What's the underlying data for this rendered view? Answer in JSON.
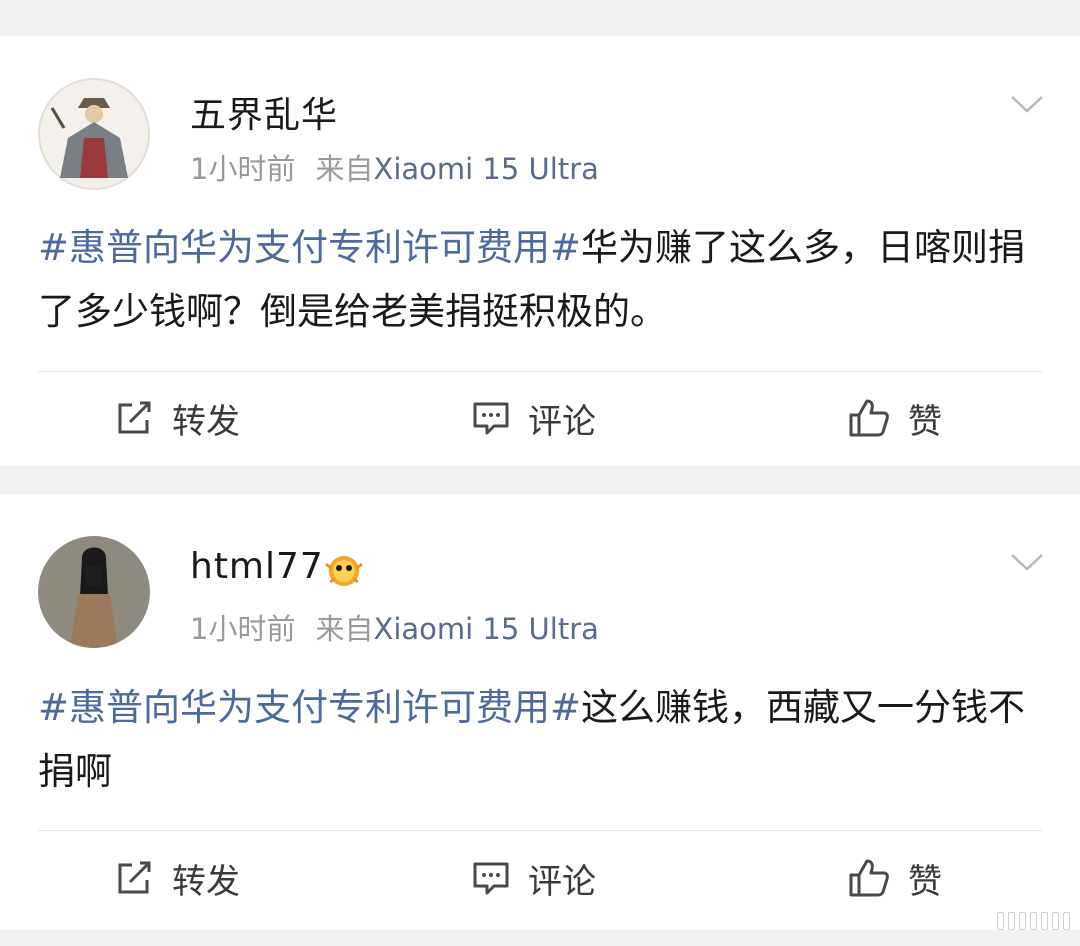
{
  "posts": [
    {
      "username": "五界乱华",
      "time": "1小时前",
      "source_prefix": "来自",
      "device": "Xiaomi 15 Ultra",
      "topic": "#惠普向华为支付专利许可费用#",
      "text": "华为赚了这么多，日喀则捐了多少钱啊？倒是给老美捐挺积极的。",
      "actions": {
        "repost": "转发",
        "comment": "评论",
        "like": "赞"
      }
    },
    {
      "username": "html77",
      "time": "1小时前",
      "source_prefix": "来自",
      "device": "Xiaomi 15 Ultra",
      "topic": "#惠普向华为支付专利许可费用#",
      "text": "这么赚钱，西藏又一分钱不捐啊",
      "actions": {
        "repost": "转发",
        "comment": "评论",
        "like": "赞"
      }
    }
  ],
  "colors": {
    "topic": "#4d6a9c",
    "device": "#5b6b8c",
    "meta": "#9a9a9a",
    "background": "#f2f2f2"
  },
  "icons": [
    "repost-icon",
    "comment-icon",
    "like-icon",
    "chevron-down-icon",
    "pufferfish-badge-icon"
  ]
}
